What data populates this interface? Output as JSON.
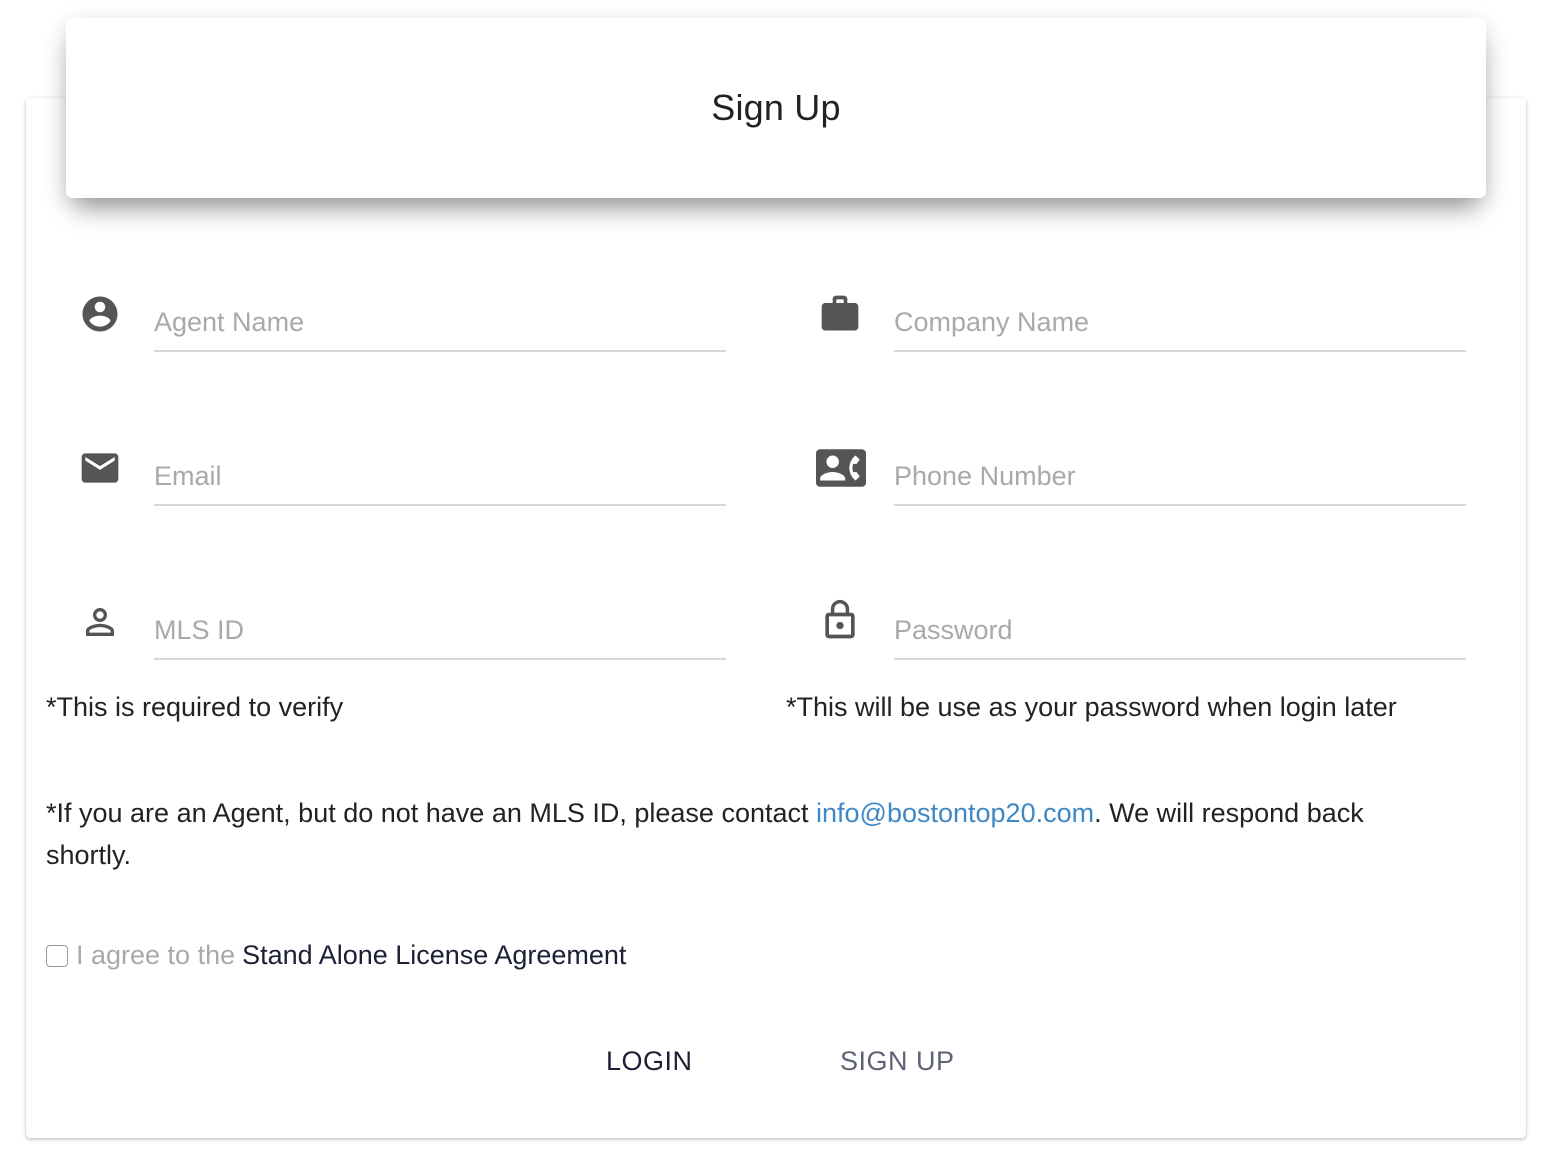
{
  "header": {
    "title": "Sign Up"
  },
  "fields": {
    "agent_name": {
      "placeholder": "Agent Name",
      "icon": "account-circle-icon"
    },
    "company_name": {
      "placeholder": "Company Name",
      "icon": "briefcase-icon"
    },
    "email": {
      "placeholder": "Email",
      "icon": "mail-icon"
    },
    "phone_number": {
      "placeholder": "Phone Number",
      "icon": "contact-phone-icon"
    },
    "mls_id": {
      "placeholder": "MLS ID",
      "icon": "person-outline-icon"
    },
    "password": {
      "placeholder": "Password",
      "icon": "lock-icon"
    }
  },
  "notes": {
    "mls_note": "*This is required to verify",
    "password_note": "*This will be use as your password when login later",
    "contact_prefix": "*If you are an Agent, but do not have an MLS ID, please contact ",
    "contact_email": "info@bostontop20.com",
    "contact_suffix": ". We will respond back shortly."
  },
  "agreement": {
    "checked": false,
    "prefix": "I agree to the",
    "link_text": "Stand Alone License Agreement"
  },
  "buttons": {
    "login": "LOGIN",
    "signup": "SIGN UP"
  },
  "colors": {
    "icon": "#555555",
    "link": "#3f88c5",
    "placeholder": "#a9a9a9",
    "underline": "#d8d8d8",
    "primary_text": "#1c2035"
  }
}
